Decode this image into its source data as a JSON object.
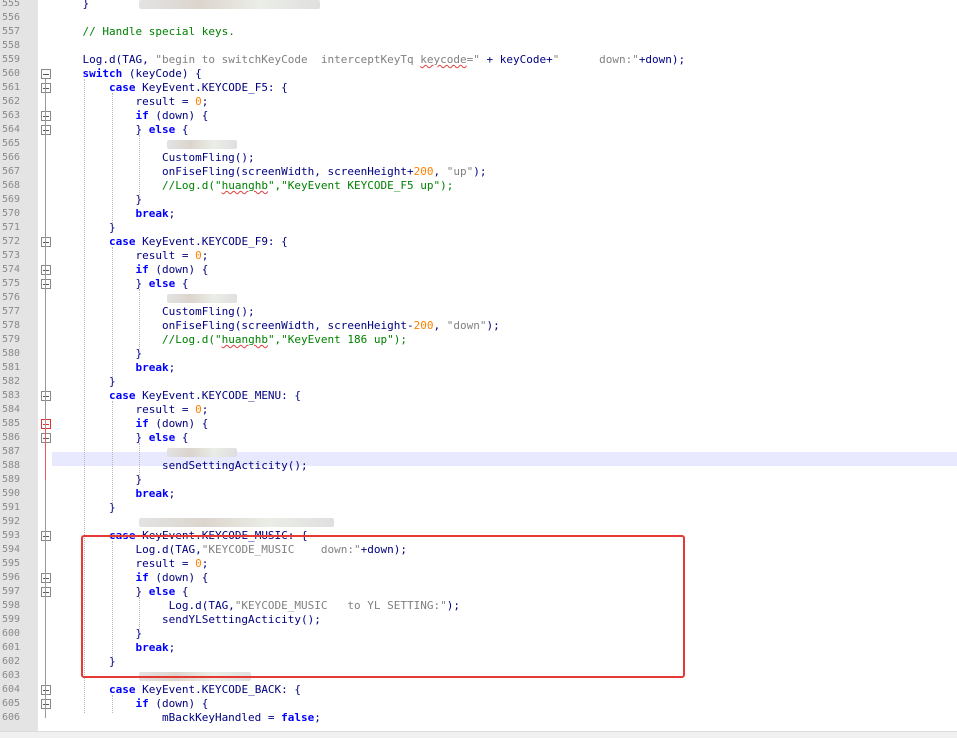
{
  "editor": {
    "lines": [
      {
        "n": "555",
        "code": "    }"
      },
      {
        "n": "556",
        "code": ""
      },
      {
        "n": "557",
        "code": "    // Handle special keys."
      },
      {
        "n": "558",
        "code": ""
      },
      {
        "n": "559",
        "code": "    Log.d(TAG, \"begin to switchKeyCode  interceptKeyTq keycode=\" + keyCode+\"      down:\"+down);"
      },
      {
        "n": "560",
        "code": "    switch (keyCode) {"
      },
      {
        "n": "561",
        "code": "        case KeyEvent.KEYCODE_F5: {"
      },
      {
        "n": "562",
        "code": "            result = 0;"
      },
      {
        "n": "563",
        "code": "            if (down) {"
      },
      {
        "n": "564",
        "code": "            } else {"
      },
      {
        "n": "565",
        "code": ""
      },
      {
        "n": "566",
        "code": "                CustomFling();"
      },
      {
        "n": "567",
        "code": "                onFiseFling(screenWidth, screenHeight+200, \"up\");"
      },
      {
        "n": "568",
        "code": "                //Log.d(\"huanghb\",\"KeyEvent KEYCODE_F5 up\");"
      },
      {
        "n": "569",
        "code": "            }"
      },
      {
        "n": "570",
        "code": "            break;"
      },
      {
        "n": "571",
        "code": "        }"
      },
      {
        "n": "572",
        "code": "        case KeyEvent.KEYCODE_F9: {"
      },
      {
        "n": "573",
        "code": "            result = 0;"
      },
      {
        "n": "574",
        "code": "            if (down) {"
      },
      {
        "n": "575",
        "code": "            } else {"
      },
      {
        "n": "576",
        "code": ""
      },
      {
        "n": "577",
        "code": "                CustomFling();"
      },
      {
        "n": "578",
        "code": "                onFiseFling(screenWidth, screenHeight-200, \"down\");"
      },
      {
        "n": "579",
        "code": "                //Log.d(\"huanghb\",\"KeyEvent 186 up\");"
      },
      {
        "n": "580",
        "code": "            }"
      },
      {
        "n": "581",
        "code": "            break;"
      },
      {
        "n": "582",
        "code": "        }"
      },
      {
        "n": "583",
        "code": "        case KeyEvent.KEYCODE_MENU: {"
      },
      {
        "n": "584",
        "code": "            result = 0;"
      },
      {
        "n": "585",
        "code": "            if (down) {"
      },
      {
        "n": "586",
        "code": "            } else {"
      },
      {
        "n": "587",
        "code": ""
      },
      {
        "n": "588",
        "code": "                sendSettingActicity();"
      },
      {
        "n": "589",
        "code": "            }"
      },
      {
        "n": "590",
        "code": "            break;"
      },
      {
        "n": "591",
        "code": "        }"
      },
      {
        "n": "592",
        "code": ""
      },
      {
        "n": "593",
        "code": "        case KeyEvent.KEYCODE_MUSIC: {"
      },
      {
        "n": "594",
        "code": "            Log.d(TAG,\"KEYCODE_MUSIC    down:\"+down);"
      },
      {
        "n": "595",
        "code": "            result = 0;"
      },
      {
        "n": "596",
        "code": "            if (down) {"
      },
      {
        "n": "597",
        "code": "            } else {"
      },
      {
        "n": "598",
        "code": "                 Log.d(TAG,\"KEYCODE_MUSIC   to YL SETTING:\");"
      },
      {
        "n": "599",
        "code": "                sendYLSettingActicity();"
      },
      {
        "n": "600",
        "code": "            }"
      },
      {
        "n": "601",
        "code": "            break;"
      },
      {
        "n": "602",
        "code": "        }"
      },
      {
        "n": "603",
        "code": ""
      },
      {
        "n": "604",
        "code": "        case KeyEvent.KEYCODE_BACK: {"
      },
      {
        "n": "605",
        "code": "            if (down) {"
      },
      {
        "n": "606",
        "code": "                mBackKeyHandled = false;"
      }
    ]
  },
  "colors": {
    "keyword": "#0000ff",
    "number": "#ff8000",
    "string": "#808080",
    "comment": "#008000",
    "identifier": "#000080",
    "annotation_box": "#e53935",
    "current_line": "#e8e8ff"
  }
}
